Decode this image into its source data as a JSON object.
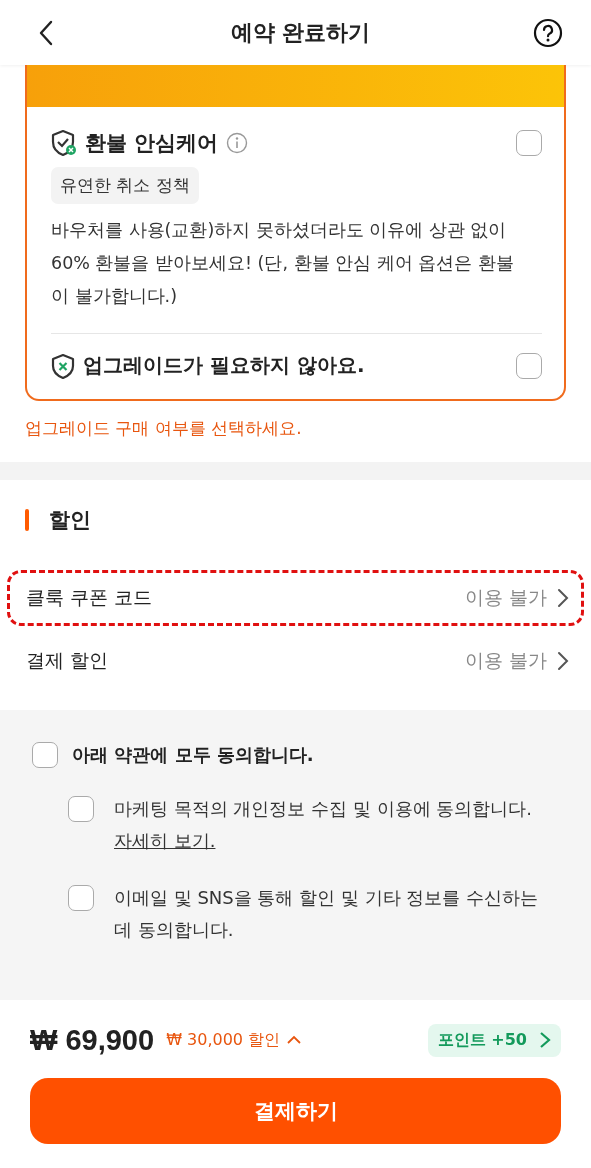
{
  "header": {
    "title": "예약 완료하기"
  },
  "upgrade_options": [
    {
      "kind": "care",
      "title": "환불 안심케어",
      "tag": "유연한 취소 정책",
      "description": "바우처를 사용(교환)하지 못하셨더라도 이유에 상관 없이 60% 환불을 받아보세요! (단, 환불 안심 케어 옵션은 환불이 불가합니다.)",
      "checked": false
    },
    {
      "kind": "none",
      "title": "업그레이드가 필요하지 않아요.",
      "checked": false
    }
  ],
  "upgrade_error": "업그레이드 구매 여부를 선택하세요.",
  "discount": {
    "title": "할인",
    "rows": [
      {
        "label": "클룩 쿠폰 코드",
        "value": "이용 불가",
        "highlighted": true
      },
      {
        "label": "결제 할인",
        "value": "이용 불가",
        "highlighted": false
      }
    ]
  },
  "agreements": {
    "all": {
      "label": "아래 약관에 모두 동의합니다.",
      "checked": false
    },
    "items": [
      {
        "text": "마케팅 목적의 개인정보 수집 및 이용에 동의합니다.",
        "link": "자세히 보기.",
        "checked": false
      },
      {
        "text": "이메일 및 SNS을 통해 할인 및 기타 정보를 수신하는 데 동의합니다.",
        "checked": false
      }
    ]
  },
  "footer": {
    "price": "₩ 69,900",
    "discount": "₩ 30,000 할인",
    "points": "포인트 +50",
    "pay_button": "결제하기"
  }
}
